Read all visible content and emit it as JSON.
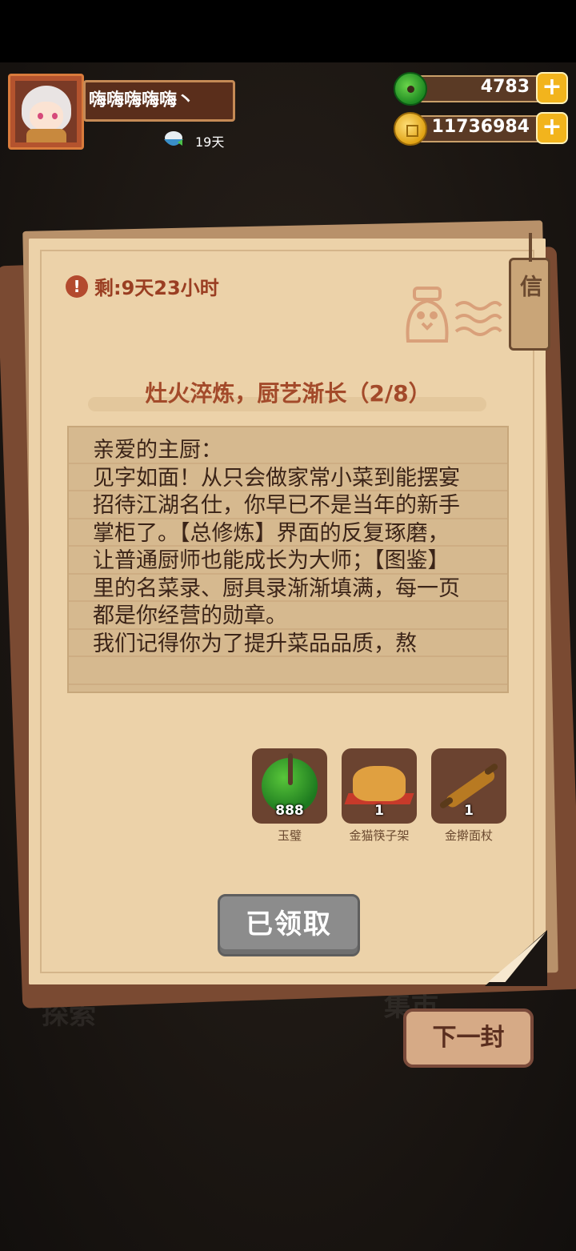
{
  "player": {
    "name": "嗨嗨嗨嗨嗨丶",
    "days": "19天"
  },
  "currency": {
    "jade": "4783",
    "coins": "11736984",
    "plus": "+"
  },
  "background_labels": [
    "探索",
    "集市"
  ],
  "letter": {
    "timer": "剩:9天23小时",
    "warning_glyph": "!",
    "tag_glyph": "信",
    "title": "灶火淬炼，厨艺渐长（2/8）",
    "body": "亲爱的主厨：\n见字如面！从只会做家常小菜到能摆宴招待江湖名仕，你早已不是当年的新手掌柜了。【总修炼】界面的反复琢磨，让普通厨师也能成长为大师；【图鉴】里的名菜录、厨具录渐渐填满，每一页都是你经营的勋章。\n我们记得你为了提升菜品品质，熬",
    "rewards": [
      {
        "icon": "jade-disc-icon",
        "qty": "888",
        "label": "玉璧"
      },
      {
        "icon": "golden-cat-chopstick-rest-icon",
        "qty": "1",
        "label": "金猫筷子架"
      },
      {
        "icon": "golden-rolling-pin-icon",
        "qty": "1",
        "label": "金擀面杖"
      }
    ],
    "claim_button": "已领取"
  },
  "next_button": "下一封",
  "colors": {
    "paper": "#ecd2a9",
    "title": "#a34a2a",
    "button_disabled": "#8c8c8c",
    "accent_gold": "#f2b41d"
  }
}
